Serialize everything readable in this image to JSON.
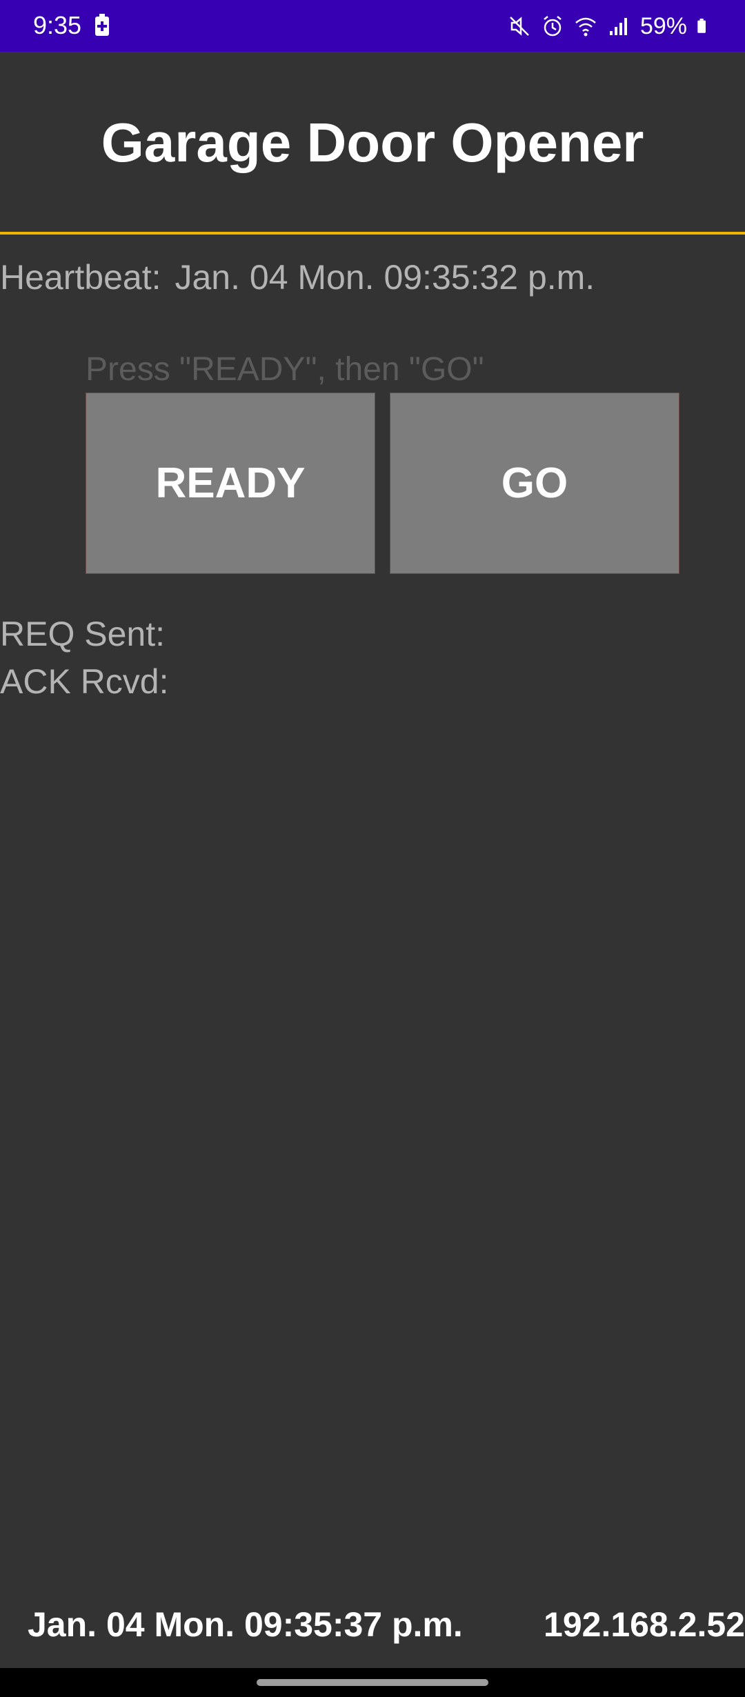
{
  "status_bar": {
    "time": "9:35",
    "battery_percent": "59%",
    "background": "#3700b3",
    "icons": [
      "battery-saver-icon",
      "mute-icon",
      "alarm-icon",
      "wifi-icon",
      "signal-icon",
      "battery-icon"
    ]
  },
  "header": {
    "title": "Garage Door Opener",
    "rule_color": "#f0b400"
  },
  "heartbeat": {
    "label": "Heartbeat:",
    "value": "Jan. 04 Mon. 09:35:32 p.m."
  },
  "instruction": "Press \"READY\", then \"GO\"",
  "buttons": {
    "ready_label": "READY",
    "go_label": "GO"
  },
  "status_rows": {
    "req_label": "REQ Sent:",
    "ack_label": "ACK Rcvd:"
  },
  "footer": {
    "timestamp": "Jan. 04 Mon. 09:35:37 p.m.",
    "ip": "192.168.2.52"
  }
}
